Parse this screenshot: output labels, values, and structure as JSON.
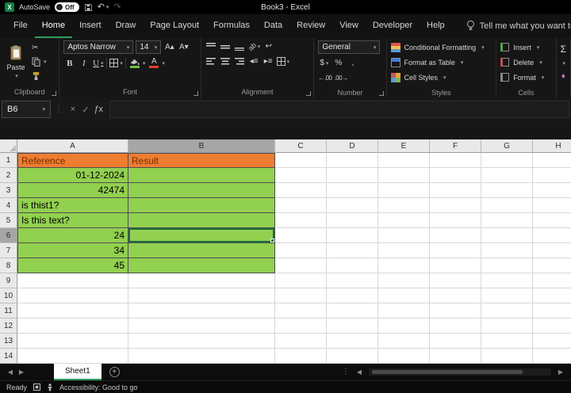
{
  "titlebar": {
    "autosave_label": "AutoSave",
    "autosave_state": "Off",
    "doc_title": "Book3 - Excel"
  },
  "tabs": {
    "items": [
      "File",
      "Home",
      "Insert",
      "Draw",
      "Page Layout",
      "Formulas",
      "Data",
      "Review",
      "View",
      "Developer",
      "Help"
    ],
    "active": "Home",
    "search_label": "Tell me what you want to do"
  },
  "ribbon": {
    "clipboard": {
      "paste_label": "Paste",
      "group_label": "Clipboard"
    },
    "font": {
      "font_name": "Aptos Narrow",
      "font_size": "14",
      "group_label": "Font"
    },
    "alignment": {
      "group_label": "Alignment"
    },
    "number": {
      "format": "General",
      "group_label": "Number"
    },
    "styles": {
      "conditional_formatting": "Conditional Formatting",
      "format_as_table": "Format as Table",
      "cell_styles": "Cell Styles",
      "group_label": "Styles"
    },
    "cells": {
      "insert": "Insert",
      "delete": "Delete",
      "format": "Format",
      "group_label": "Cells"
    }
  },
  "formula_bar": {
    "name_box": "B6",
    "formula": ""
  },
  "grid": {
    "columns": [
      "A",
      "B",
      "C",
      "D",
      "E",
      "F",
      "G",
      "H"
    ],
    "col_widths": {
      "A": 140,
      "B": 185,
      "default": 65
    },
    "row_count": 14,
    "active_cell": "B6",
    "selected_column": "B",
    "selected_row": 6,
    "cells": {
      "A1": "Reference",
      "B1": "Result",
      "A2": "01-12-2024",
      "A3": "42474",
      "A4": "is thist1?",
      "A5": "Is this text?",
      "A6": "24",
      "A7": "34",
      "A8": "45"
    },
    "orange_cells": [
      "A1",
      "B1"
    ],
    "green_cells": [
      "A2",
      "B2",
      "A3",
      "B3",
      "A4",
      "B4",
      "A5",
      "B5",
      "A6",
      "B6",
      "A7",
      "B7",
      "A8",
      "B8"
    ],
    "right_aligned": [
      "A2",
      "A3",
      "A6",
      "A7",
      "A8"
    ]
  },
  "sheet_bar": {
    "active_tab": "Sheet1",
    "add_label": "+"
  },
  "status_bar": {
    "mode": "Ready",
    "accessibility": "Accessibility: Good to go"
  },
  "colors": {
    "orange": "#ED7D31",
    "orange_text": "#772B00",
    "green": "#92D050",
    "accent": "#2f9e5d",
    "selection": "#1a6e3c"
  }
}
